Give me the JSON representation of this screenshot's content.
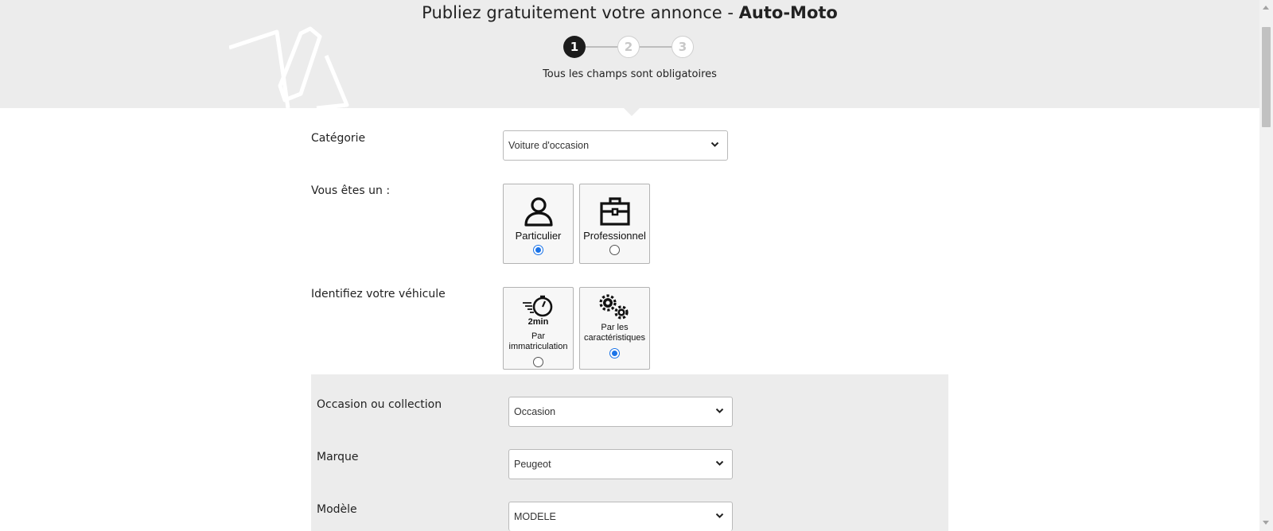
{
  "header": {
    "title_prefix": "Publiez gratuitement votre annonce - ",
    "title_brand": "Auto-Moto",
    "steps": [
      "1",
      "2",
      "3"
    ],
    "subtitle": "Tous les champs sont obligatoires"
  },
  "form": {
    "categorie": {
      "label": "Catégorie",
      "value": "Voiture d'occasion"
    },
    "vous_etes": {
      "label": "Vous êtes un :",
      "options": [
        {
          "label": "Particulier",
          "icon": "person-icon",
          "selected": true
        },
        {
          "label": "Professionnel",
          "icon": "briefcase-icon",
          "selected": false
        }
      ]
    },
    "identifiez": {
      "label": "Identifiez votre véhicule",
      "options": [
        {
          "badge": "2min",
          "label": "Par immatriculation",
          "icon": "stopwatch-icon",
          "selected": false
        },
        {
          "label": "Par les caractéristiques",
          "icon": "gears-icon",
          "selected": true
        }
      ]
    },
    "occasion": {
      "label": "Occasion ou collection",
      "value": "Occasion"
    },
    "marque": {
      "label": "Marque",
      "value": "Peugeot"
    },
    "modele": {
      "label": "Modèle",
      "value": "MODELE"
    }
  },
  "colors": {
    "radio_accent": "#1a73e8",
    "header_bg": "#ececec",
    "step_active": "#1c1c1c"
  }
}
